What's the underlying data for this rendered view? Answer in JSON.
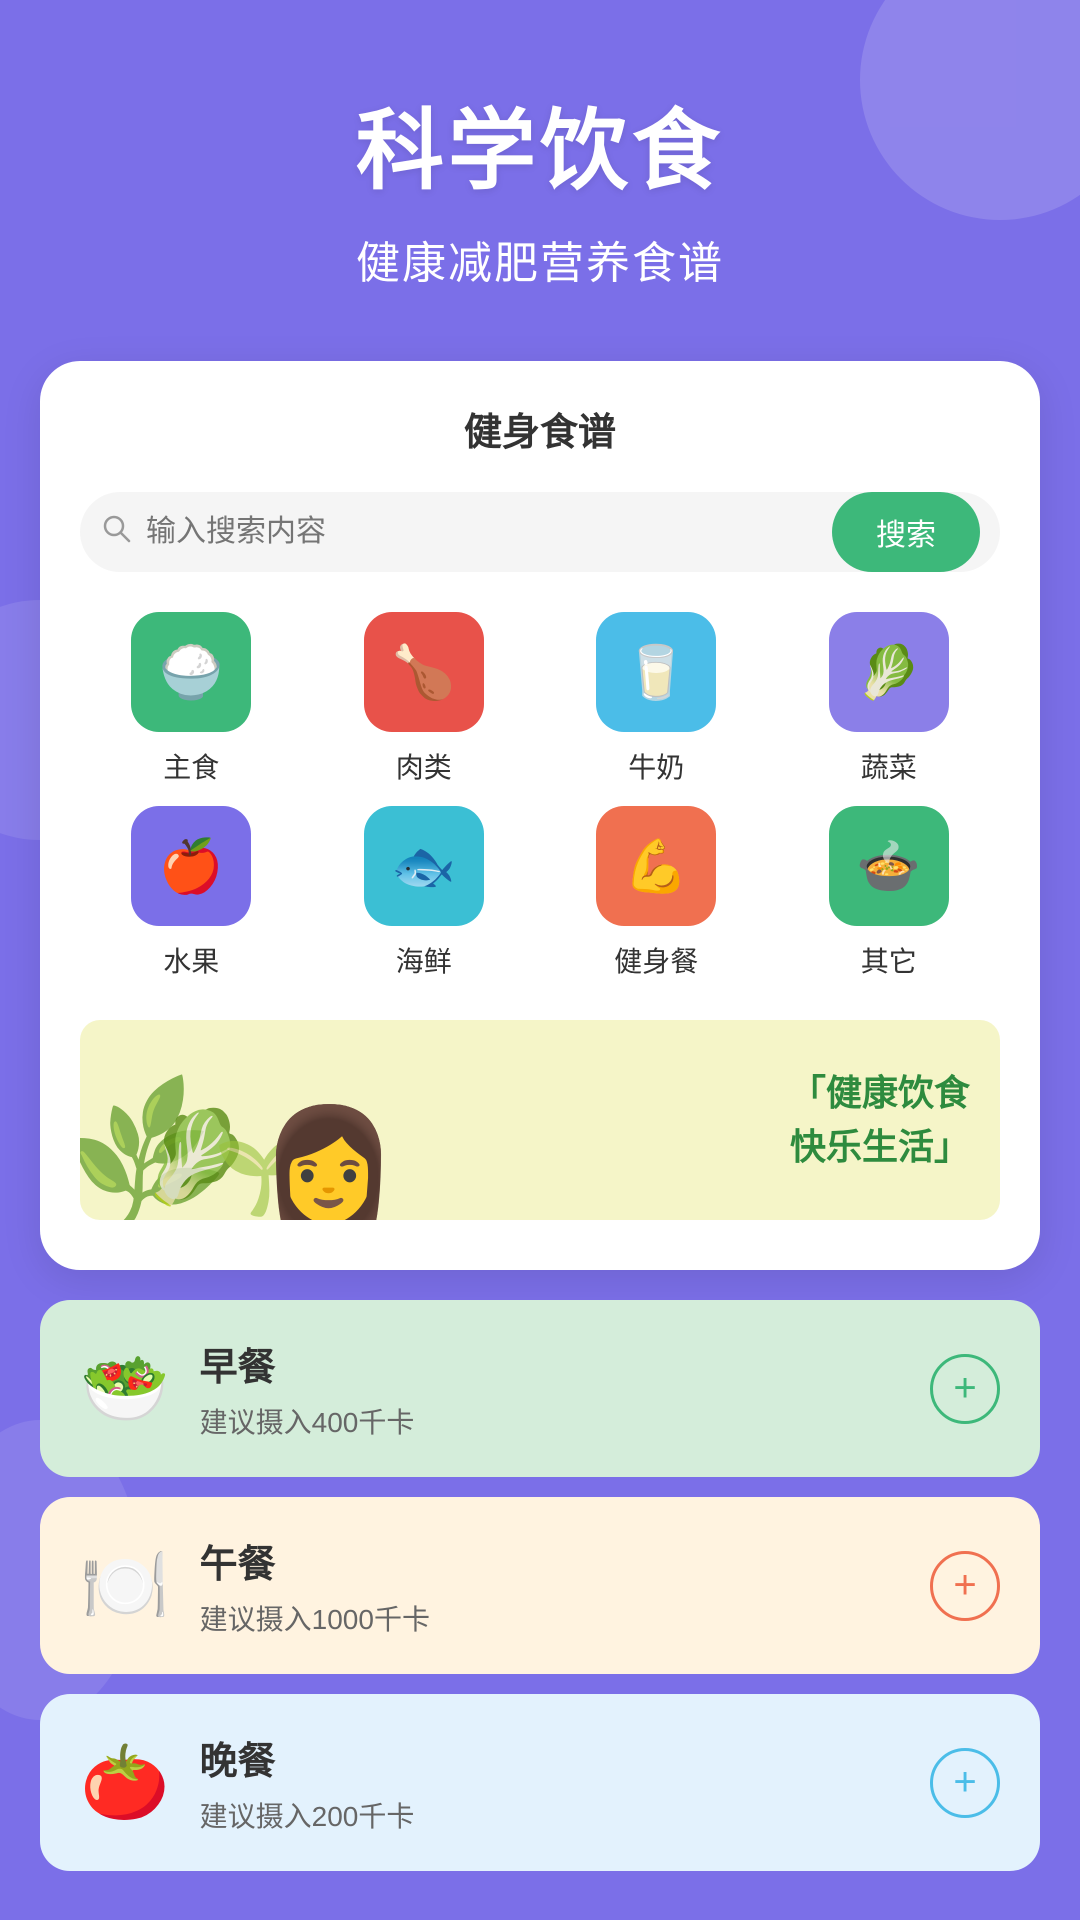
{
  "header": {
    "title": "科学饮食",
    "subtitle": "健康减肥营养食谱"
  },
  "card": {
    "title": "健身食谱",
    "search": {
      "placeholder": "输入搜索内容",
      "button_label": "搜索"
    },
    "categories": [
      {
        "id": "staple",
        "label": "主食",
        "icon": "🍚",
        "color_class": "icon-green",
        "emoji": "🍚"
      },
      {
        "id": "meat",
        "label": "肉类",
        "icon": "🍗",
        "color_class": "icon-red",
        "emoji": "🍗"
      },
      {
        "id": "milk",
        "label": "牛奶",
        "icon": "🥛",
        "color_class": "icon-blue",
        "emoji": "🥛"
      },
      {
        "id": "vegetable",
        "label": "蔬菜",
        "icon": "🥬",
        "color_class": "icon-purple",
        "emoji": "🥬"
      },
      {
        "id": "fruit",
        "label": "水果",
        "icon": "🍎",
        "color_class": "icon-purple2",
        "emoji": "🍎"
      },
      {
        "id": "seafood",
        "label": "海鲜",
        "icon": "🐟",
        "color_class": "icon-teal",
        "emoji": "🐟"
      },
      {
        "id": "fitness",
        "label": "健身餐",
        "icon": "💪",
        "color_class": "icon-orange",
        "emoji": "💪"
      },
      {
        "id": "other",
        "label": "其它",
        "icon": "🍲",
        "color_class": "icon-green2",
        "emoji": "🍲"
      }
    ],
    "banner": {
      "text_line1": "「健康饮食",
      "text_line2": "快乐生活」"
    }
  },
  "meals": [
    {
      "id": "breakfast",
      "name": "早餐",
      "desc": "建议摄入400千卡",
      "emoji": "🥗",
      "card_color": "meal-card-breakfast",
      "btn_color": "add-btn-green"
    },
    {
      "id": "lunch",
      "name": "午餐",
      "desc": "建议摄入1000千卡",
      "emoji": "🍽️",
      "card_color": "meal-card-lunch",
      "btn_color": "add-btn-orange"
    },
    {
      "id": "dinner",
      "name": "晚餐",
      "desc": "建议摄入200千卡",
      "emoji": "🍅",
      "card_color": "meal-card-dinner",
      "btn_color": "add-btn-blue"
    }
  ]
}
